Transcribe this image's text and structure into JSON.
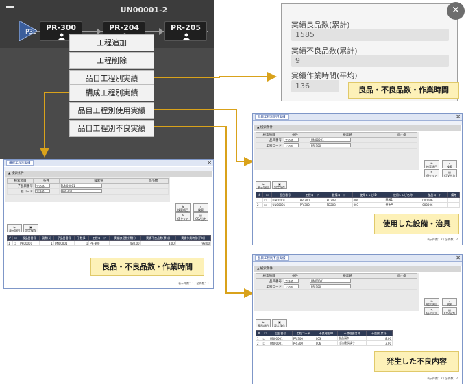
{
  "canvas": {
    "route_id": "UN00001-2",
    "start_node": "P39",
    "processes": [
      "PR-300",
      "PR-204",
      "PR-205"
    ]
  },
  "context_menu": {
    "items": [
      "工程追加",
      "工程削除",
      "品目工程別実績",
      "構成工程別実績",
      "品目工程別使用実績",
      "品目工程別不良実績"
    ]
  },
  "popup": {
    "fields": [
      {
        "label": "実績良品数(累計)",
        "value": "1585"
      },
      {
        "label": "実績不良品数(累計)",
        "value": "9"
      },
      {
        "label": "実績作業時間(平均)",
        "value": "136"
      }
    ],
    "callout": "良品・不良品数・作業時間"
  },
  "callouts": {
    "left": "良品・不良品数・作業時間",
    "usage": "使用した設備・治具",
    "defect": "発生した不良内容"
  },
  "windows": {
    "common": {
      "section": "検索条件",
      "cond_headers": [
        "検索項目",
        "条件",
        "検索値",
        "品小数"
      ],
      "cond_is": "である",
      "btn_search_items": "検索項目",
      "btn_search": "検索",
      "btn_clear": "値クリア",
      "btn_csv": "CSV出力",
      "btn_display": "表示項目",
      "btn_save": "設定保存"
    },
    "left": {
      "title": "構成工程別実績",
      "cond_rows": [
        {
          "item": "子品目番号",
          "value": "UN00001"
        },
        {
          "item": "工程コード",
          "value": "PR-300"
        }
      ],
      "headers": [
        "#",
        "",
        "親品目番号",
        "親数(1)",
        "子品目番号",
        "子数(1)",
        "工程コード",
        "実績良品数(累計)",
        "実績不良品数(累計)",
        "実績作業時間(平均)"
      ],
      "rows": [
        [
          "1",
          "",
          "PR00001",
          "1",
          "UN00001",
          "1",
          "PR-300",
          "480.00",
          "8.00",
          "98.00"
        ]
      ],
      "status": "表示件数：1 / 全件数：1"
    },
    "usage": {
      "title": "品目工程別使用実績",
      "cond_rows": [
        {
          "item": "品目番号",
          "value": "UN00001"
        },
        {
          "item": "工程コード",
          "value": "PR-300"
        }
      ],
      "headers": [
        "#",
        "",
        "品目番号",
        "工程コード",
        "設備コード",
        "使用レシピID",
        "使用レシピ名称",
        "部品コード",
        "備考"
      ],
      "rows": [
        [
          "1",
          "",
          "UN00001",
          "PR-300",
          "PD203",
          "000",
          "基板1",
          "000006",
          ""
        ],
        [
          "2",
          "",
          "UN00001",
          "PR-300",
          "PD203",
          "007",
          "基板A",
          "000006",
          ""
        ]
      ],
      "status": "表示件数：2 / 全件数：2"
    },
    "defect": {
      "title": "品目工程別不良実績",
      "cond_rows": [
        {
          "item": "品目番号",
          "value": "UN00001"
        },
        {
          "item": "工程コード",
          "value": "PR-300"
        }
      ],
      "headers": [
        "#",
        "",
        "品目番号",
        "工程コード",
        "不良理由ID",
        "不良理由名称",
        "不良数(累計)"
      ],
      "rows": [
        [
          "1",
          "",
          "UN00001",
          "PR-300",
          "003",
          "部品漏れ",
          "8.00"
        ],
        [
          "2",
          "",
          "UN00001",
          "PR-300",
          "006",
          "寸法違反誤り",
          "3.00"
        ]
      ],
      "status": "表示件数：2 / 全件数：2"
    }
  },
  "colors": {
    "canvas_bg": "#4a4a4a",
    "connector": "#d9a21b",
    "callout_bg": "#fdf1b8",
    "table_header": "#2e3a55"
  }
}
